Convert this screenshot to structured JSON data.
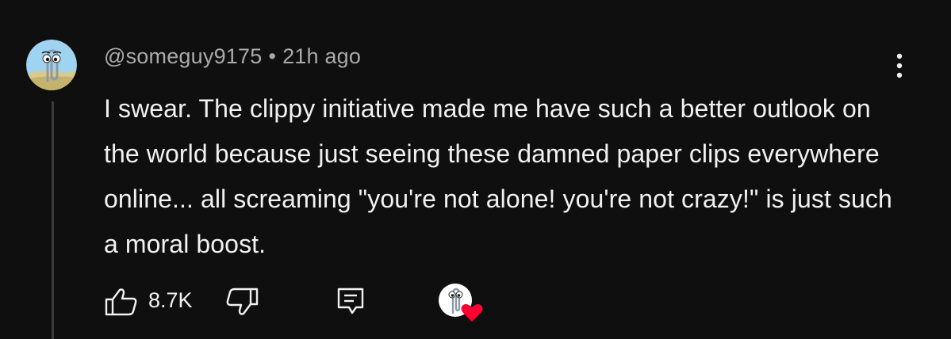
{
  "comment": {
    "username": "@someguy9175",
    "separator": "•",
    "time": "21h ago",
    "text": "I swear. The clippy initiative made me have such a better outlook on the world because just seeing these damned paper clips everywhere online... all screaming \"you're not alone! you're not crazy!\" is just such a moral boost."
  },
  "actions": {
    "like_count": "8.7K",
    "like_icon": "thumbs-up-icon",
    "dislike_icon": "thumbs-down-icon",
    "reply_icon": "reply-comment-icon",
    "creator_heart_icon": "creator-heart-icon",
    "more_icon": "more-vertical-icon"
  },
  "colors": {
    "background": "#0f0f0f",
    "text": "#f1f1f1",
    "meta": "#aaaaaa",
    "heart": "#ff0033"
  }
}
